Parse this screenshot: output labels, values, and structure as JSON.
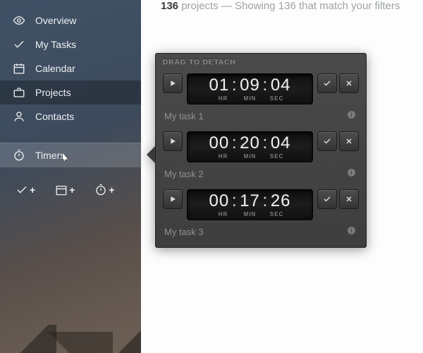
{
  "sidebar": {
    "items": [
      {
        "icon": "eye-icon",
        "label": "Overview"
      },
      {
        "icon": "check-icon",
        "label": "My Tasks"
      },
      {
        "icon": "calendar-icon",
        "label": "Calendar"
      },
      {
        "icon": "briefcase-icon",
        "label": "Projects",
        "active": true
      },
      {
        "icon": "user-icon",
        "label": "Contacts"
      }
    ],
    "timers_label": "Timers"
  },
  "header": {
    "count": "136",
    "rest": " projects — Showing 136 that match your filters"
  },
  "panel": {
    "title": "DRAG TO DETACH",
    "unit_labels": {
      "hr": "HR",
      "min": "MIN",
      "sec": "SEC"
    },
    "timers": [
      {
        "hr": "01",
        "min": "09",
        "sec": "04",
        "name": "My task 1"
      },
      {
        "hr": "00",
        "min": "20",
        "sec": "04",
        "name": "My task 2"
      },
      {
        "hr": "00",
        "min": "17",
        "sec": "26",
        "name": "My task 3"
      }
    ]
  }
}
